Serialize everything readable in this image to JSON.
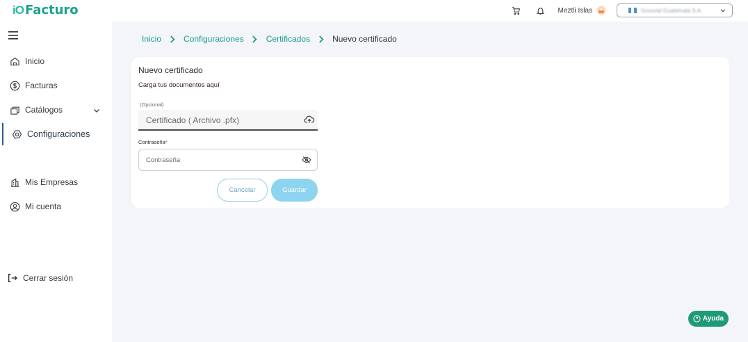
{
  "app": {
    "logo_mark": "iO",
    "logo_text": "Facturo"
  },
  "header": {
    "user_name": "Meztli Islas",
    "company_name": "Grooviel Guatemala S.A.",
    "icons": [
      "cart-icon",
      "bell-icon",
      "user-avatar-icon",
      "chevron-down-icon"
    ]
  },
  "sidebar": {
    "items": [
      {
        "label": "Inicio",
        "icon": "home-icon"
      },
      {
        "label": "Facturas",
        "icon": "dollar-circle-icon"
      },
      {
        "label": "Catálogos",
        "icon": "catalog-icon"
      },
      {
        "label": "Configuraciones",
        "icon": "gear-icon",
        "active": true
      },
      {
        "label": "Mis Empresas",
        "icon": "building-icon"
      },
      {
        "label": "Mi cuenta",
        "icon": "account-circle-icon"
      }
    ],
    "logout": "Cerrar sesión"
  },
  "breadcrumb": [
    "Inicio",
    "Configuraciones",
    "Certificados",
    "Nuevo certificado"
  ],
  "form": {
    "title": "Nuevo certificado",
    "subtitle": "Carga tus documentos aquí",
    "optional_label": "(Opcional)",
    "file_placeholder": "Certificado ( Archivo .pfx)",
    "password_label": "Contraseña",
    "password_required_mark": "*",
    "password_placeholder": "Contraseña",
    "cancel_label": "Cancelar",
    "save_label": "Guardar"
  },
  "help": {
    "label": "Ayuda"
  },
  "colors": {
    "accent": "#1a9b8c",
    "help": "#1f9a78",
    "save": "#8ed3ef",
    "active_bar": "#2c5a8a"
  }
}
